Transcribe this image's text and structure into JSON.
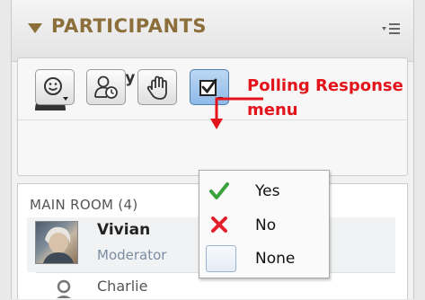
{
  "header": {
    "title": "PARTICIPANTS",
    "menu_icon": "panel-menu-icon",
    "accent": "#8b6e3a"
  },
  "you": {
    "name": "Ricky",
    "avatar_icon": "user-silhouette-icon"
  },
  "toolbar": {
    "buttons": [
      {
        "name": "mood-button",
        "icon": "smiley-icon",
        "has_dropdown": true
      },
      {
        "name": "away-button",
        "icon": "away-clock-icon",
        "has_dropdown": false
      },
      {
        "name": "raise-hand-button",
        "icon": "hand-icon",
        "has_dropdown": false
      },
      {
        "name": "polling-response-button",
        "icon": "checkbox-icon",
        "has_dropdown": true,
        "active": true
      }
    ]
  },
  "callout": {
    "line1": "Polling Response",
    "line2": "menu",
    "color": "#e3141b"
  },
  "room": {
    "label": "MAIN ROOM (4)",
    "participants": [
      {
        "name": "Vivian",
        "role": "Moderator"
      },
      {
        "name": "Charlie",
        "role": ""
      }
    ]
  },
  "poll_menu": {
    "items": [
      {
        "label": "Yes",
        "icon": "check-icon",
        "color": "#3aa23a"
      },
      {
        "label": "No",
        "icon": "x-icon",
        "color": "#e0202b"
      },
      {
        "label": "None",
        "icon": "blank-box-icon",
        "color": "#9ab3cf"
      }
    ]
  }
}
